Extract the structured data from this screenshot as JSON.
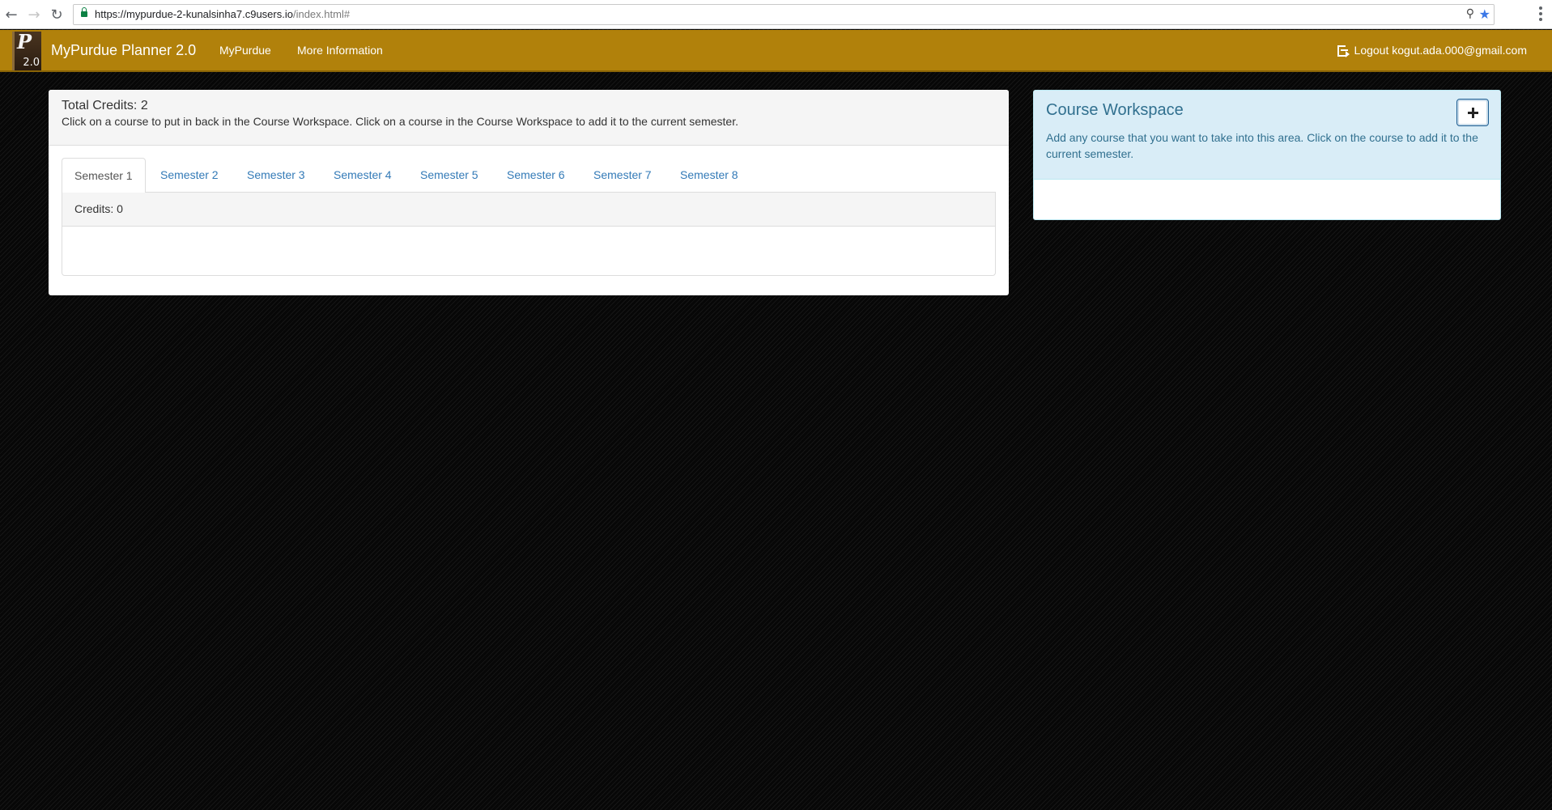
{
  "browser": {
    "url_host": "https://mypurdue-2-kunalsinha7.c9users.io",
    "url_path": "/index.html#"
  },
  "navbar": {
    "logo_letter": "P",
    "logo_version": "2.0",
    "brand": "MyPurdue Planner 2.0",
    "links": [
      "MyPurdue",
      "More Information"
    ],
    "logout_label": "Logout kogut.ada.000@gmail.com",
    "background_color": "#b1810b"
  },
  "planner": {
    "total_credits": "Total Credits: 2",
    "help_text": "Click on a course to put in back in the Course Workspace. Click on a course in the Course Workspace to add it to the current semester.",
    "tabs": [
      "Semester 1",
      "Semester 2",
      "Semester 3",
      "Semester 4",
      "Semester 5",
      "Semester 6",
      "Semester 7",
      "Semester 8"
    ],
    "active_tab": "Semester 1",
    "semester_credits": "Credits: 0"
  },
  "workspace": {
    "title": "Course Workspace",
    "description": "Add any course that you want to take into this area. Click on the course to add it to the current semester.",
    "add_button_icon": "plus-icon"
  }
}
